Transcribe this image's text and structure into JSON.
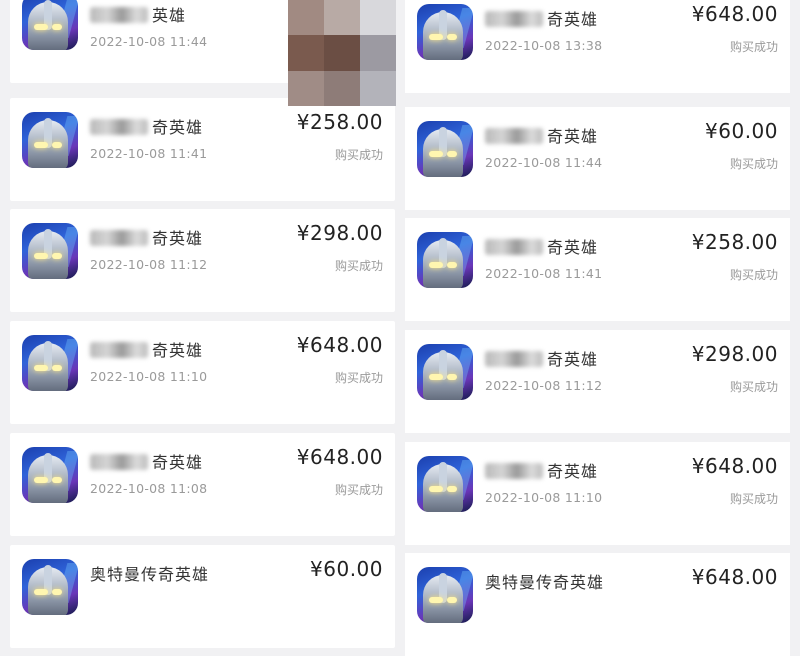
{
  "colors": {
    "background": "#f1f1f3",
    "card": "#ffffff",
    "price": "#222222",
    "muted": "#9a9a9a"
  },
  "app_icon": "ultraman-game-icon",
  "left_column": [
    {
      "title": "英雄",
      "time": "2022-10-08 11:44",
      "price": "",
      "status": ""
    },
    {
      "title": "奇英雄",
      "time": "2022-10-08 11:41",
      "price": "¥258.00",
      "status": "购买成功"
    },
    {
      "title": "奇英雄",
      "time": "2022-10-08 11:12",
      "price": "¥298.00",
      "status": "购买成功"
    },
    {
      "title": "奇英雄",
      "time": "2022-10-08 11:10",
      "price": "¥648.00",
      "status": "购买成功"
    },
    {
      "title": "奇英雄",
      "time": "2022-10-08 11:08",
      "price": "¥648.00",
      "status": "购买成功"
    },
    {
      "title": "奥特曼传奇英雄",
      "time": "",
      "price": "¥60.00",
      "status": ""
    }
  ],
  "right_column": [
    {
      "title": "奇英雄",
      "time": "2022-10-08 13:38",
      "price": "¥648.00",
      "status": "购买成功"
    },
    {
      "title": "奇英雄",
      "time": "2022-10-08 11:44",
      "price": "¥60.00",
      "status": "购买成功"
    },
    {
      "title": "奇英雄",
      "time": "2022-10-08 11:41",
      "price": "¥258.00",
      "status": "购买成功"
    },
    {
      "title": "奇英雄",
      "time": "2022-10-08 11:12",
      "price": "¥298.00",
      "status": "购买成功"
    },
    {
      "title": "奇英雄",
      "time": "2022-10-08 11:10",
      "price": "¥648.00",
      "status": "购买成功"
    },
    {
      "title": "奥特曼传奇英雄",
      "time": "",
      "price": "¥648.00",
      "status": ""
    }
  ]
}
